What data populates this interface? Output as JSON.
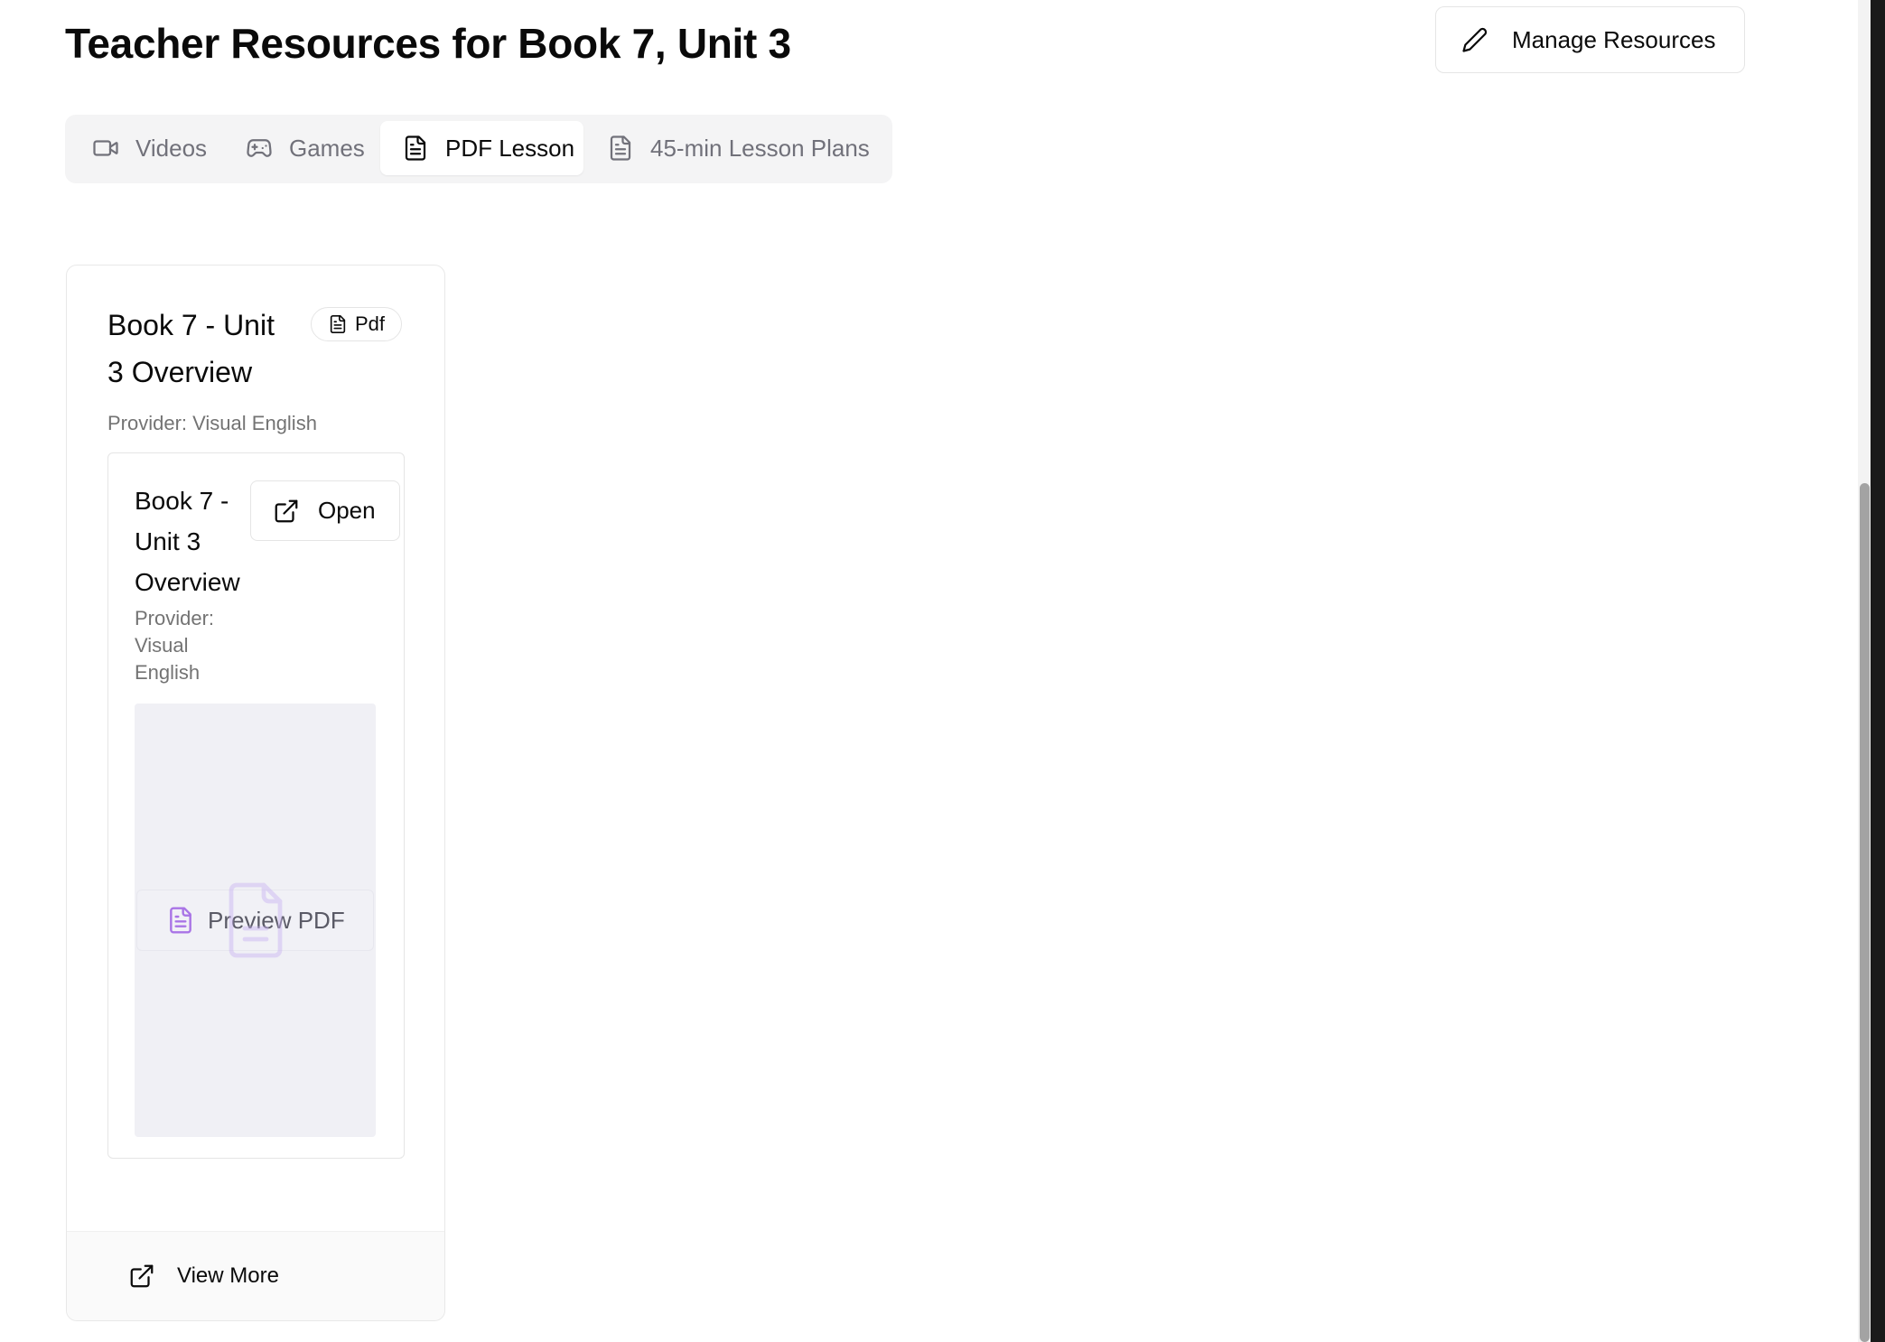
{
  "header": {
    "title": "Teacher Resources for Book 7, Unit 3",
    "manage_label": "Manage Resources",
    "manage_icon": "pencil-icon"
  },
  "tabs": [
    {
      "label": "Videos",
      "icon": "video-icon",
      "active": false
    },
    {
      "label": "Games",
      "icon": "gamepad-icon",
      "active": false
    },
    {
      "label": "PDF Lesson",
      "icon": "file-text-icon",
      "active": true
    },
    {
      "label": "45-min Lesson Plans",
      "icon": "file-text-icon",
      "active": false
    }
  ],
  "resource_card": {
    "title": "Book 7 - Unit 3 Overview",
    "badge": "Pdf",
    "provider": "Provider: Visual English",
    "pdf": {
      "title": "Book 7 - Unit 3 Overview",
      "provider": "Provider: Visual English",
      "open_label": "Open",
      "preview_label": "Preview PDF"
    },
    "view_more_label": "View More"
  },
  "colors": {
    "accent_purple": "#a974e6",
    "preview_bg": "#f0f0f5",
    "tab_bar_bg": "#f4f4f5"
  }
}
